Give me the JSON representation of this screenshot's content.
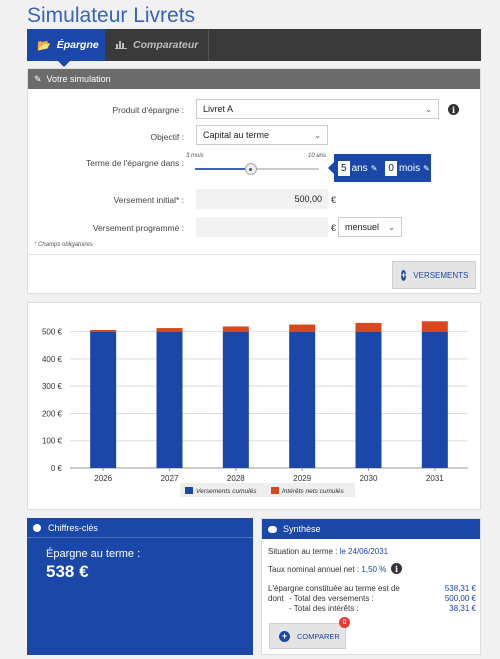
{
  "app_title": "Simulateur Livrets",
  "tabs": [
    {
      "label": "Épargne",
      "icon": "folder-open-icon"
    },
    {
      "label": "Comparateur",
      "icon": "bar-chart-icon"
    }
  ],
  "simulation": {
    "header": "Votre simulation",
    "produit_label": "Produit d'épargne :",
    "produit_value": "Livret A",
    "objectif_label": "Objectif :",
    "objectif_value": "Capital au terme",
    "terme_label": "Terme de l'épargne dans :",
    "slider_min": "3 mois",
    "slider_max": "10 ans",
    "slider_level": 0.45,
    "terme_ans": "5",
    "terme_ans_unit": "ans",
    "terme_mois": "0",
    "terme_mois_unit": "mois",
    "versement_initial_label": "Versement initial* :",
    "versement_initial_value": "500,00",
    "versement_programme_label": "Versement programmé :",
    "versement_programme_value": "",
    "currency": "€",
    "frequence_value": "mensuel",
    "required_note": "Champs obligatoires",
    "versements_button": "VERSEMENTS"
  },
  "chart_data": {
    "type": "bar",
    "stacked": true,
    "categories": [
      "2026",
      "2027",
      "2028",
      "2029",
      "2030",
      "2031"
    ],
    "series": [
      {
        "name": "Versements cumulés",
        "values": [
          500,
          500,
          500,
          500,
          500,
          500
        ],
        "color": "#1a47a8"
      },
      {
        "name": "Intérêts nets cumulés",
        "values": [
          6,
          13,
          19,
          26,
          32,
          38
        ],
        "color": "#d9481c"
      }
    ],
    "y_ticks": [
      "0 €",
      "100 €",
      "200 €",
      "300 €",
      "400 €",
      "500 €"
    ],
    "ylim": [
      0,
      550
    ],
    "grid": true,
    "legend_position": "bottom"
  },
  "chiffres": {
    "header": "Chiffres-clés",
    "label": "Épargne au terme :",
    "value": "538 €"
  },
  "synthese": {
    "header": "Synthèse",
    "situation_label": "Situation au terme :",
    "situation_value": "le 24/06/2031",
    "taux_label": "Taux nominal annuel net :",
    "taux_value": "1,50 %",
    "epargne_label": "L'épargne constituée au terme est de",
    "epargne_value": "538,31 €",
    "dont": "dont",
    "total_versements_label": "- Total des versements :",
    "total_versements_value": "500,00 €",
    "total_interets_label": "- Total des intérêts :",
    "total_interets_value": "38,31 €",
    "comparer_button": "COMPARER",
    "comparer_badge": "0"
  }
}
